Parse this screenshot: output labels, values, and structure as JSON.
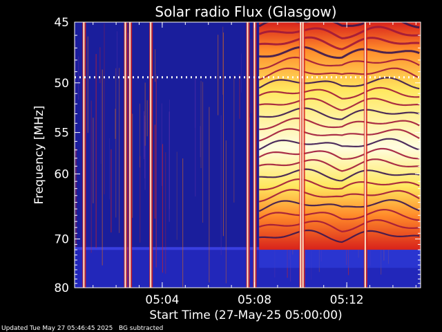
{
  "chart_data": {
    "type": "heatmap",
    "title": "Solar radio Flux (Glasgow)",
    "xlabel": "Start Time (27-May-25 05:00:00)",
    "ylabel": "Frequency [MHz]",
    "x_unit": "minutes after 05:00",
    "xlim": [
      0.2,
      15.2
    ],
    "ylim": [
      45,
      80
    ],
    "y_scale": "reciprocal (frequency increases downward, tick spacing shrinks)",
    "y_ticks": [
      45,
      50,
      55,
      60,
      70,
      80
    ],
    "x_ticks": [
      {
        "minute": 4,
        "label": "05:04"
      },
      {
        "minute": 8,
        "label": "05:08"
      },
      {
        "minute": 12,
        "label": "05:12"
      }
    ],
    "colors": {
      "background": "#1a1e9c",
      "band_low": "#2a2fd4",
      "dark_band": "#3a1650",
      "mid": "#d8221b",
      "bright": "#ff8a2a",
      "yellow": "#ffe860",
      "white": "#fffde0"
    },
    "burst": {
      "start_minute": 8.2,
      "end_minute": 15.2,
      "freq_range_mhz": [
        45,
        72
      ],
      "description": "intense broadband emission with drifting striations"
    },
    "bright_vertical_streaks_minutes": [
      0.6,
      2.4,
      2.6,
      3.5,
      7.7,
      8.0,
      10.0,
      10.1,
      12.8
    ],
    "marker_line_mhz": 49.5
  },
  "footer": {
    "text": "Updated Tue May 27 05:46:45 2025   BG subtracted"
  }
}
